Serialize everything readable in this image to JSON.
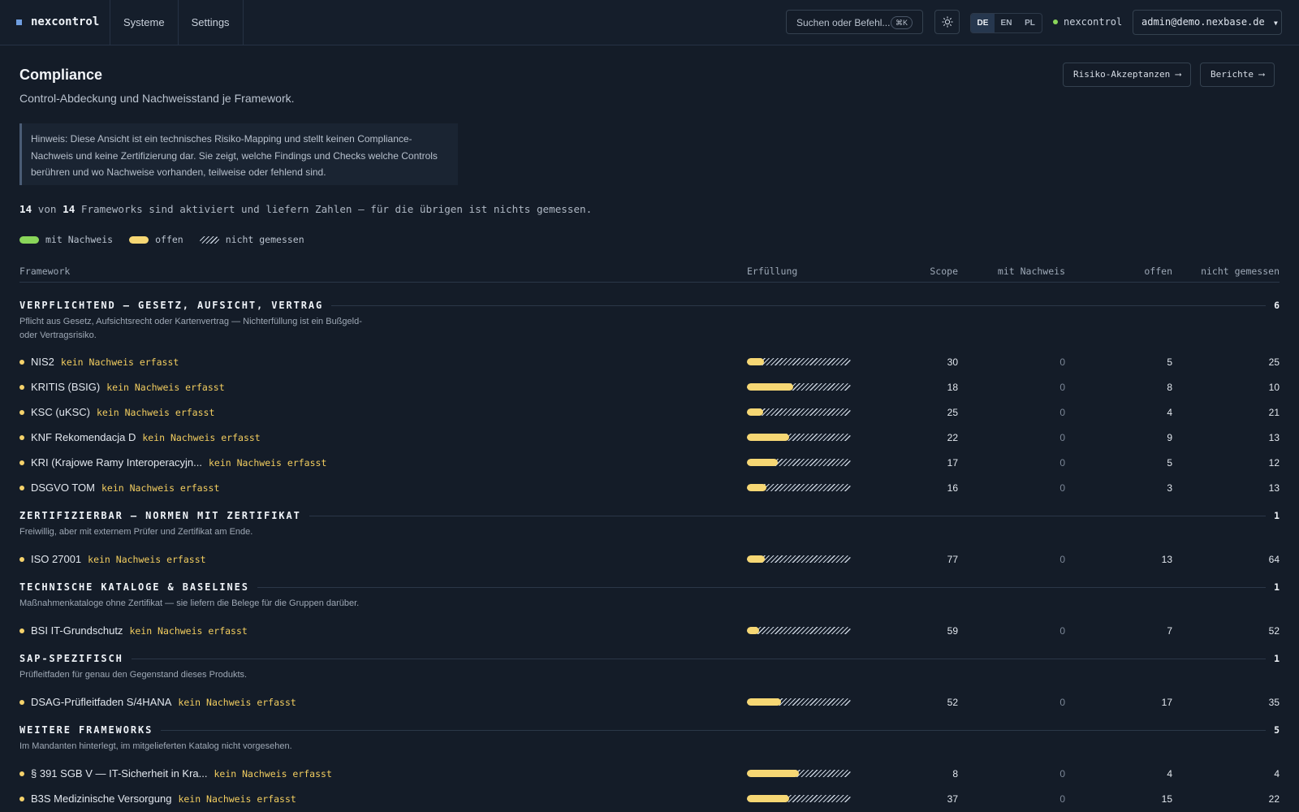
{
  "app": {
    "name": "nexcontrol"
  },
  "nav": [
    {
      "label": "Systeme"
    },
    {
      "label": "Settings"
    }
  ],
  "search": {
    "placeholder": "Suchen oder Befehl...",
    "shortcut": "⌘K"
  },
  "languages": [
    {
      "code": "DE",
      "active": true
    },
    {
      "code": "EN",
      "active": false
    },
    {
      "code": "PL",
      "active": false
    }
  ],
  "tenant": {
    "name": "nexcontrol",
    "status_color": "#8ad65a"
  },
  "user": {
    "email": "admin@demo.nexbase.de"
  },
  "page": {
    "title": "Compliance",
    "subtitle": "Control-Abdeckung und Nachweisstand je Framework.",
    "actions": [
      {
        "label": "Risiko-Akzeptanzen ⟶"
      },
      {
        "label": "Berichte ⟶"
      }
    ],
    "notice_lines": [
      "Hinweis: Diese Ansicht ist ein technisches Risiko-Mapping und stellt keinen Compliance-",
      "Nachweis und keine Zertifizierung dar. Sie zeigt, welche Findings und Checks welche Controls",
      "berühren und wo Nachweise vorhanden, teilweise oder fehlend sind."
    ],
    "summary": {
      "active": "14",
      "total": "14",
      "text_von": "von",
      "text_rest": "Frameworks sind aktiviert und liefern Zahlen — für die übrigen ist nichts gemessen."
    }
  },
  "legend": [
    {
      "label": "mit Nachweis",
      "color": "#8ad65a"
    },
    {
      "label": "offen",
      "color": "#f6d774"
    },
    {
      "label": "nicht gemessen",
      "pattern": "hatch"
    }
  ],
  "table": {
    "columns": {
      "framework": "Framework",
      "fulfillment": "Erfüllung",
      "scope": "Scope",
      "evidence": "mit Nachweis",
      "open": "offen",
      "unmeasured": "nicht gemessen"
    },
    "groups": [
      {
        "title": "VERPFLICHTEND — GESETZ, AUFSICHT, VERTRAG",
        "count": "6",
        "description": "Pflicht aus Gesetz, Aufsichtsrecht oder Kartenvertrag — Nichterfüllung ist ein Bußgeld- oder Vertragsrisiko.",
        "rows": [
          {
            "name": "NIS2",
            "badge": "kein Nachweis erfasst",
            "scope": "30",
            "evidence": "0",
            "open": "5",
            "unmeasured": "25"
          },
          {
            "name": "KRITIS (BSIG)",
            "badge": "kein Nachweis erfasst",
            "scope": "18",
            "evidence": "0",
            "open": "8",
            "unmeasured": "10"
          },
          {
            "name": "KSC (uKSC)",
            "badge": "kein Nachweis erfasst",
            "scope": "25",
            "evidence": "0",
            "open": "4",
            "unmeasured": "21"
          },
          {
            "name": "KNF Rekomendacja D",
            "badge": "kein Nachweis erfasst",
            "scope": "22",
            "evidence": "0",
            "open": "9",
            "unmeasured": "13"
          },
          {
            "name": "KRI (Krajowe Ramy Interoperacyjn...",
            "badge": "kein Nachweis erfasst",
            "scope": "17",
            "evidence": "0",
            "open": "5",
            "unmeasured": "12"
          },
          {
            "name": "DSGVO TOM",
            "badge": "kein Nachweis erfasst",
            "scope": "16",
            "evidence": "0",
            "open": "3",
            "unmeasured": "13"
          }
        ]
      },
      {
        "title": "ZERTIFIZIERBAR — NORMEN MIT ZERTIFIKAT",
        "count": "1",
        "description": "Freiwillig, aber mit externem Prüfer und Zertifikat am Ende.",
        "rows": [
          {
            "name": "ISO 27001",
            "badge": "kein Nachweis erfasst",
            "scope": "77",
            "evidence": "0",
            "open": "13",
            "unmeasured": "64"
          }
        ]
      },
      {
        "title": "TECHNISCHE KATALOGE & BASELINES",
        "count": "1",
        "description": "Maßnahmenkataloge ohne Zertifikat — sie liefern die Belege für die Gruppen darüber.",
        "rows": [
          {
            "name": "BSI IT-Grundschutz",
            "badge": "kein Nachweis erfasst",
            "scope": "59",
            "evidence": "0",
            "open": "7",
            "unmeasured": "52"
          }
        ]
      },
      {
        "title": "SAP-SPEZIFISCH",
        "count": "1",
        "description": "Prüfleitfaden für genau den Gegenstand dieses Produkts.",
        "rows": [
          {
            "name": "DSAG-Prüfleitfaden S/4HANA",
            "badge": "kein Nachweis erfasst",
            "scope": "52",
            "evidence": "0",
            "open": "17",
            "unmeasured": "35"
          }
        ]
      },
      {
        "title": "WEITERE FRAMEWORKS",
        "count": "5",
        "description": "Im Mandanten hinterlegt, im mitgelieferten Katalog nicht vorgesehen.",
        "rows": [
          {
            "name": "§ 391 SGB V — IT-Sicherheit in Kra...",
            "badge": "kein Nachweis erfasst",
            "scope": "8",
            "evidence": "0",
            "open": "4",
            "unmeasured": "4"
          },
          {
            "name": "B3S Medizinische Versorgung",
            "badge": "kein Nachweis erfasst",
            "scope": "37",
            "evidence": "0",
            "open": "15",
            "unmeasured": "22"
          }
        ]
      }
    ]
  }
}
